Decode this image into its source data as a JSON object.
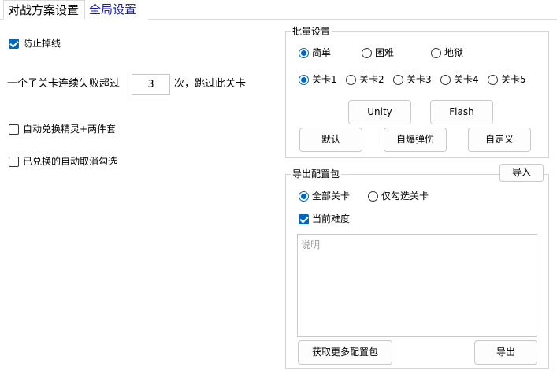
{
  "tabs": {
    "battle_plan": "对战方案设置",
    "global": "全局设置"
  },
  "left": {
    "prevent_disconnect": {
      "label": "防止掉线",
      "checked": true
    },
    "fail_prefix": "一个子关卡连续失败超过",
    "fail_count": "3",
    "fail_suffix": "次，跳过此关卡",
    "auto_redeem": {
      "label": "自动兑换精灵+两件套",
      "checked": false
    },
    "auto_uncheck": {
      "label": "已兑换的自动取消勾选",
      "checked": false
    }
  },
  "batch": {
    "title": "批量设置",
    "difficulty": [
      {
        "label": "简单",
        "checked": true
      },
      {
        "label": "困难",
        "checked": false
      },
      {
        "label": "地狱",
        "checked": false
      }
    ],
    "levels": [
      {
        "label": "关卡1",
        "checked": true
      },
      {
        "label": "关卡2",
        "checked": false
      },
      {
        "label": "关卡3",
        "checked": false
      },
      {
        "label": "关卡4",
        "checked": false
      },
      {
        "label": "关卡5",
        "checked": false
      }
    ],
    "buttons": {
      "unity": "Unity",
      "flash": "Flash",
      "default": "默认",
      "self_destruct": "自爆弹伤",
      "custom": "自定义"
    }
  },
  "export": {
    "title": "导出配置包",
    "import_button": "导入",
    "scope": [
      {
        "label": "全部关卡",
        "checked": true
      },
      {
        "label": "仅勾选关卡",
        "checked": false
      }
    ],
    "current_difficulty": {
      "label": "当前难度",
      "checked": true
    },
    "description_placeholder": "说明",
    "more_button": "获取更多配置包",
    "export_button": "导出"
  },
  "colors": {
    "accent": "#0067c0",
    "tab_inactive": "#1a1aa6"
  }
}
